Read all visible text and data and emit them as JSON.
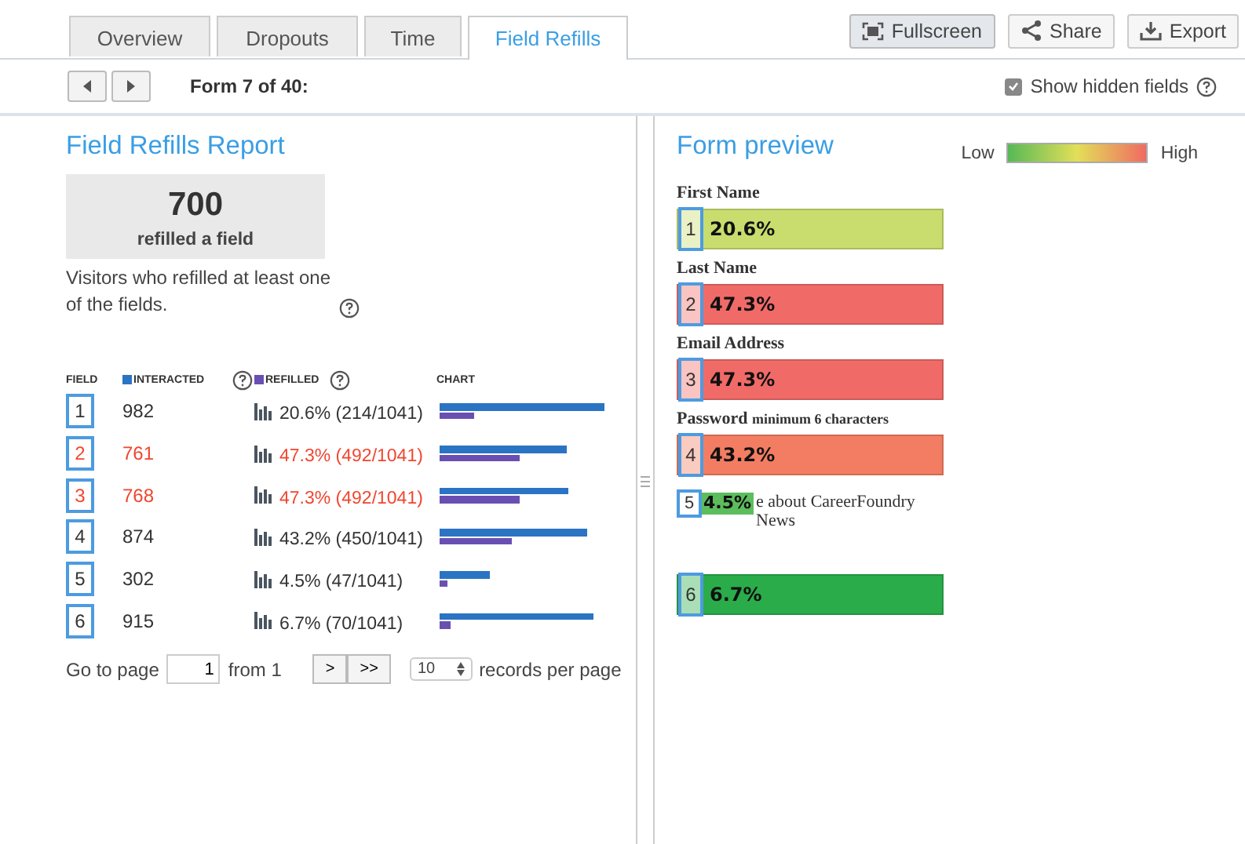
{
  "tabs": [
    {
      "label": "Overview",
      "selected": false
    },
    {
      "label": "Dropouts",
      "selected": false
    },
    {
      "label": "Time",
      "selected": false
    },
    {
      "label": "Field Refills",
      "selected": true
    }
  ],
  "actions": [
    {
      "label": "Fullscreen",
      "kind": "fullscreen",
      "selected": true
    },
    {
      "label": "Share",
      "kind": "share",
      "selected": false
    },
    {
      "label": "Export",
      "kind": "export",
      "selected": false
    }
  ],
  "toolbar": {
    "form_label": "Form 7 of 40:",
    "show_hidden": {
      "label": "Show hidden fields",
      "checked": true
    }
  },
  "report": {
    "title": "Field Refills Report",
    "stat_value": "700",
    "stat_label": "refilled a field",
    "description": "Visitors who refilled at least one of the fields.",
    "columns": [
      "FIELD",
      "INTERACTED",
      "REFILLED",
      "CHART"
    ],
    "rows": [
      {
        "field": "1",
        "interacted": "982",
        "refilled": "20.6% (214/1041)",
        "highlighted": false
      },
      {
        "field": "2",
        "interacted": "761",
        "refilled": "47.3% (492/1041)",
        "highlighted": true
      },
      {
        "field": "3",
        "interacted": "768",
        "refilled": "47.3% (492/1041)",
        "highlighted": true
      },
      {
        "field": "4",
        "interacted": "874",
        "refilled": "43.2% (450/1041)",
        "highlighted": false
      },
      {
        "field": "5",
        "interacted": "302",
        "refilled": "4.5% (47/1041)",
        "highlighted": false
      },
      {
        "field": "6",
        "interacted": "915",
        "refilled": "6.7% (70/1041)",
        "highlighted": false
      }
    ],
    "pager": {
      "label": "Go to page",
      "page": "1",
      "from": "from 1",
      "next": ">",
      "last": ">>",
      "per_page": "10",
      "per_page_label": "records per page"
    }
  },
  "preview": {
    "title": "Form preview",
    "legend_low": "Low",
    "legend_high": "High",
    "fields": [
      {
        "kind": "input",
        "label": "First Name",
        "number": "1",
        "value": "20.6%",
        "color": "#c9dc6e"
      },
      {
        "kind": "input",
        "label": "Last Name",
        "number": "2",
        "value": "47.3%",
        "color": "#f06b68"
      },
      {
        "kind": "input",
        "label": "Email Address",
        "number": "3",
        "value": "47.3%",
        "color": "#f06b68"
      },
      {
        "kind": "input",
        "label": "Password",
        "hint": "minimum 6 characters",
        "number": "4",
        "value": "43.2%",
        "color": "#f37d62"
      },
      {
        "kind": "checkbox",
        "label": "e about CareerFoundry News",
        "number": "5",
        "value": "4.5%",
        "color": "#5cbd5c"
      },
      {
        "kind": "input",
        "number": "6",
        "value": "6.7%",
        "color": "#2bac4a"
      }
    ]
  }
}
